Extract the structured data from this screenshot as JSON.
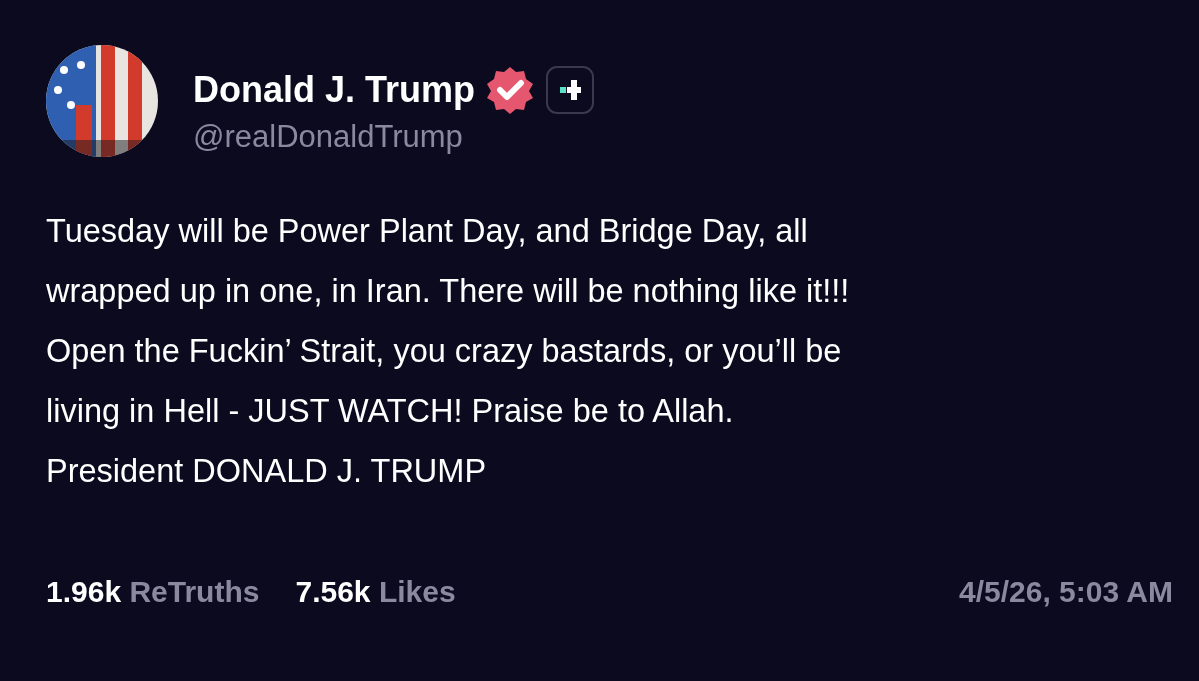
{
  "author": {
    "name": "Donald J. Trump",
    "handle": "@realDonaldTrump",
    "verified": true
  },
  "post": {
    "lines": [
      "Tuesday will be Power Plant Day, and Bridge Day, all",
      "wrapped up in one, in Iran. There will be nothing like it!!!",
      "Open the Fuckin’ Strait, you crazy bastards, or you’ll be",
      "living in Hell - JUST WATCH! Praise be to Allah.",
      "President DONALD J. TRUMP"
    ]
  },
  "stats": [
    {
      "count": "1.96k",
      "label": "ReTruths"
    },
    {
      "count": "7.56k",
      "label": "Likes"
    }
  ],
  "timestamp": "4/5/26, 5:03 AM"
}
